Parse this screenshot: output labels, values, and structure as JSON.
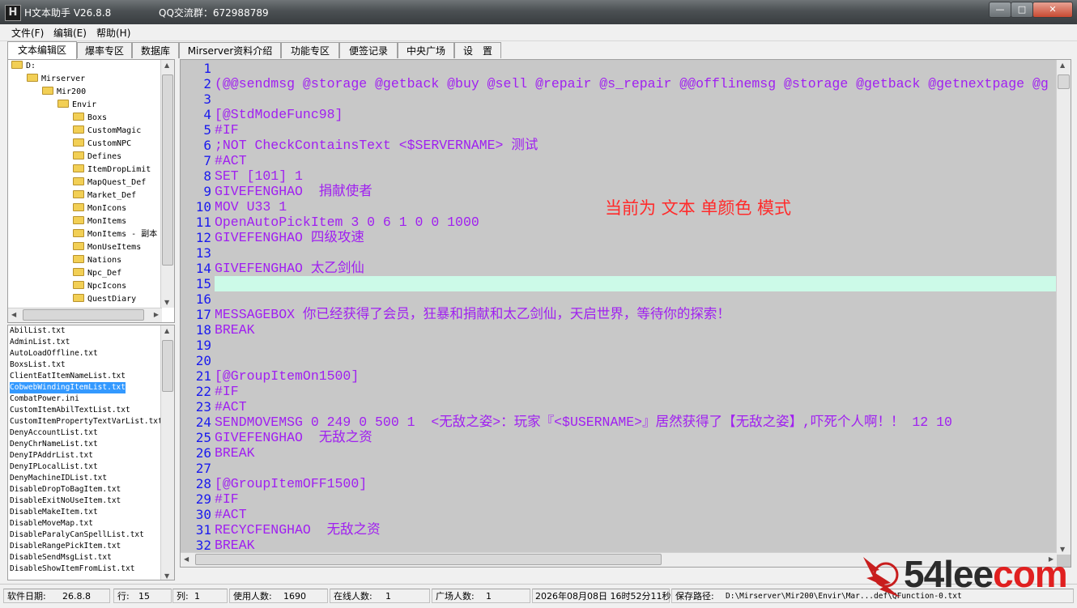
{
  "window": {
    "app_icon_letter": "H",
    "title": "H文本助手  V26.8.8",
    "qq": "QQ交流群：672988789",
    "min_label": "—",
    "max_label": "□",
    "close_label": "✕"
  },
  "menu": [
    "文件(F)",
    "编辑(E)",
    "帮助(H)"
  ],
  "tabs": [
    "文本编辑区",
    "爆率专区",
    "数据库",
    "Mirserver资料介绍",
    "功能专区",
    "便签记录",
    "中央广场",
    "设　置"
  ],
  "active_tab_index": 0,
  "tree": [
    {
      "label": "D:",
      "depth": 0
    },
    {
      "label": "Mirserver",
      "depth": 1
    },
    {
      "label": "Mir200",
      "depth": 2
    },
    {
      "label": "Envir",
      "depth": 3
    },
    {
      "label": "Boxs",
      "depth": 4
    },
    {
      "label": "CustomMagic",
      "depth": 4
    },
    {
      "label": "CustomNPC",
      "depth": 4
    },
    {
      "label": "Defines",
      "depth": 4
    },
    {
      "label": "ItemDropLimit",
      "depth": 4
    },
    {
      "label": "MapQuest_Def",
      "depth": 4
    },
    {
      "label": "Market_Def",
      "depth": 4
    },
    {
      "label": "MonIcons",
      "depth": 4
    },
    {
      "label": "MonItems",
      "depth": 4
    },
    {
      "label": "MonItems - 副本",
      "depth": 4
    },
    {
      "label": "MonUseItems",
      "depth": 4
    },
    {
      "label": "Nations",
      "depth": 4
    },
    {
      "label": "Npc_Def",
      "depth": 4
    },
    {
      "label": "NpcIcons",
      "depth": 4
    },
    {
      "label": "QuestDiary",
      "depth": 4
    }
  ],
  "files": [
    "AbilList.txt",
    "AdminList.txt",
    "AutoLoadOffline.txt",
    "BoxsList.txt",
    "ClientEatItemNameList.txt",
    "CobwebWindingItemList.txt",
    "CombatPower.ini",
    "CustomItemAbilTextList.txt",
    "CustomItemPropertyTextVarList.txt",
    "DenyAccountList.txt",
    "DenyChrNameList.txt",
    "DenyIPAddrList.txt",
    "DenyIPLocalList.txt",
    "DenyMachineIDList.txt",
    "DisableDropToBagItem.txt",
    "DisableExitNoUseItem.txt",
    "DisableMakeItem.txt",
    "DisableMoveMap.txt",
    "DisableParalyCanSpellList.txt",
    "DisableRangePickItem.txt",
    "DisableSendMsgList.txt",
    "DisableShowItemFromList.txt"
  ],
  "selected_file_index": 5,
  "editor": {
    "current_line": 15,
    "mode_label": "当前为  文本  单颜色 模式",
    "text_color": "#a020f0",
    "line_number_color": "#1a1aee",
    "background": "#c8c8c8",
    "current_line_color": "#ccfae8",
    "lines": [
      "",
      "(@@sendmsg @storage @getback @buy @sell @repair @s_repair @@offlinemsg @storage @getback @getnextpage @g",
      "",
      "[@StdModeFunc98]",
      "#IF",
      ";NOT CheckContainsText <$SERVERNAME> 测试",
      "#ACT",
      "SET [101] 1",
      "GIVEFENGHAO  捐献使者",
      "MOV U33 1",
      "OpenAutoPickItem 3 0 6 1 0 0 1000",
      "GIVEFENGHAO 四级攻速",
      "",
      "GIVEFENGHAO 太乙剑仙",
      "",
      "",
      "MESSAGEBOX 你已经获得了会员，狂暴和捐献和太乙剑仙，天启世界，等待你的探索！",
      "BREAK",
      "",
      "",
      "[@GroupItemOn1500]",
      "#IF",
      "#ACT",
      "SENDMOVEMSG 0 249 0 500 1  <无敌之姿>：玩家『<$USERNAME>』居然获得了【无敌之姿】,吓死个人啊！！ 12 10",
      "GIVEFENGHAO  无敌之资",
      "BREAK",
      "",
      "[@GroupItemOFF1500]",
      "#IF",
      "#ACT",
      "RECYCFENGHAO  无敌之资",
      "BREAK",
      ""
    ]
  },
  "status": [
    {
      "label": "软件日期:",
      "value": "26.8.8"
    },
    {
      "label": "行:",
      "value": "15"
    },
    {
      "label": "列:",
      "value": "1"
    },
    {
      "label": "使用人数:",
      "value": "1690"
    },
    {
      "label": "在线人数:",
      "value": "1"
    },
    {
      "label": "广场人数:",
      "value": "1"
    },
    {
      "label": "",
      "value": "2026年08月08日 16时52分11秒"
    },
    {
      "label": "保存路径:",
      "value": "D:\\Mirserver\\Mir200\\Envir\\Mar...def\\QFunction-0.txt"
    }
  ],
  "watermark": {
    "text": "54lee",
    "suffix": "com"
  }
}
